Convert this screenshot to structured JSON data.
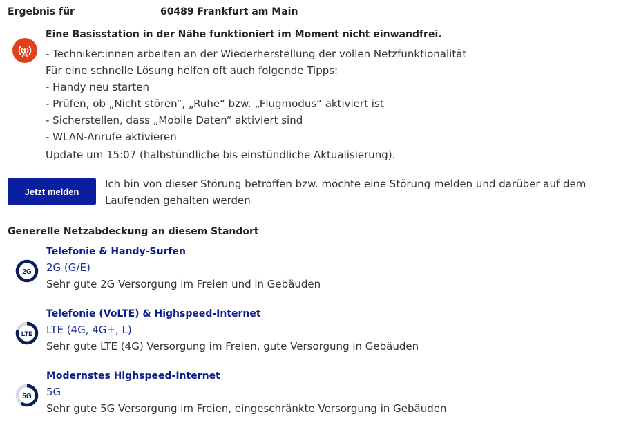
{
  "result": {
    "prefix": "Ergebnis für",
    "location": "60489 Frankfurt am Main"
  },
  "alert": {
    "icon": "signal-tower-icon",
    "icon_color": "#e2401c",
    "title": "Eine Basisstation in der Nähe funktioniert im Moment nicht einwandfrei.",
    "lines": [
      "- Techniker:innen arbeiten an der Wiederherstellung der vollen Netzfunktionalität",
      "Für eine schnelle Lösung helfen oft auch folgende Tipps:",
      "- Handy neu starten",
      "- Prüfen, ob „Nicht stören“, „Ruhe“ bzw. „Flugmodus“ aktiviert ist",
      "- Sicherstellen, dass „Mobile Daten“ aktiviert sind",
      "- WLAN-Anrufe aktivieren"
    ],
    "update": "Update um 15:07 (halbstündliche bis einstündliche Aktualisierung)."
  },
  "report": {
    "button_label": "Jetzt melden",
    "button_color": "#0a1ea0",
    "description": "Ich bin von dieser Störung betroffen bzw. möchte eine Störung melden und darüber auf dem Laufenden gehalten werden"
  },
  "coverage": {
    "heading": "Generelle Netzabdeckung an diesem Standort",
    "items": [
      {
        "icon_label": "2G",
        "signal_level": 1.0,
        "title": "Telefonie & Handy-Surfen",
        "tech": "2G (G/E)",
        "description": "Sehr gute 2G Versorgung im Freien und in Gebäuden"
      },
      {
        "icon_label": "LTE",
        "signal_level": 0.8,
        "title": "Telefonie (VoLTE) & Highspeed-Internet",
        "tech": "LTE (4G, 4G+, L)",
        "description": "Sehr gute LTE (4G) Versorgung im Freien, gute Versorgung in Gebäuden"
      },
      {
        "icon_label": "5G",
        "signal_level": 0.6,
        "title": "Modernstes Highspeed-Internet",
        "tech": "5G",
        "description": "Sehr gute 5G Versorgung im Freien, eingeschränkte Versorgung in Gebäuden"
      }
    ]
  },
  "colors": {
    "brand_blue": "#0a1e8c",
    "ring_blue": "#0a1e5a",
    "ring_track": "#d6d9e3",
    "divider": "#bdbdbd"
  }
}
